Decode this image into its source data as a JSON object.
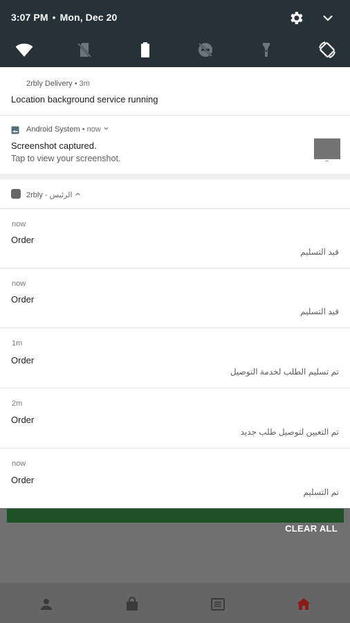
{
  "status_bar": {
    "time": "3:07 PM",
    "separator": "•",
    "date": "Mon, Dec 20",
    "icons": [
      "gear-icon",
      "chevron-down-icon"
    ]
  },
  "quick_settings": [
    "wifi-icon",
    "sim-off-icon",
    "battery-icon",
    "do-not-disturb-off-icon",
    "flashlight-icon",
    "auto-rotate-icon"
  ],
  "notifications": {
    "delivery": {
      "app": "2rbly Delivery",
      "meta": "• 3m",
      "title": "Location background service running"
    },
    "android": {
      "app": "Android System",
      "meta": "• now",
      "title": "Screenshot captured.",
      "subtitle": "Tap to view your screenshot."
    },
    "group": {
      "app": "2rbly",
      "meta": "- الرئيس",
      "items": [
        {
          "time": "now",
          "title": "Order",
          "text": "قيد التسليم"
        },
        {
          "time": "now",
          "title": "Order",
          "text": "قيد التسليم"
        },
        {
          "time": "1m",
          "title": "Order",
          "text": "تم تسليم الطلب لخدمة التوصيل"
        },
        {
          "time": "2m",
          "title": "Order",
          "text": "تم التعيين لتوصيل طلب جديد"
        },
        {
          "time": "now",
          "title": "Order",
          "text": "تم التسليم"
        }
      ]
    }
  },
  "clear_all": "CLEAR ALL",
  "bottom_nav": [
    "person-icon",
    "shopping-bag-icon",
    "list-icon",
    "home-icon"
  ],
  "colors": {
    "shade": "#263238",
    "app_accent": "#1f4f24",
    "home_active": "#8b1a1a"
  }
}
